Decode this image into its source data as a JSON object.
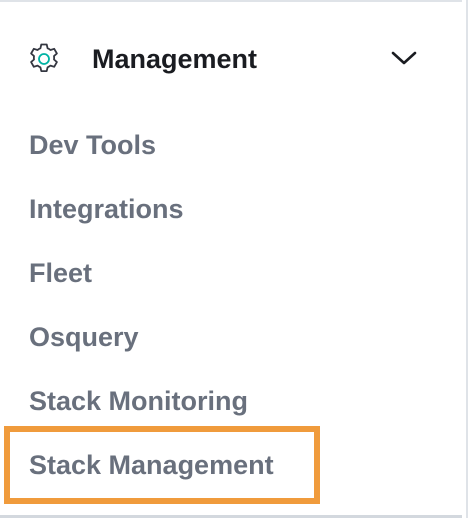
{
  "section": {
    "title": "Management",
    "icon": "gear-icon",
    "toggle_icon": "chevron-down-icon",
    "expanded": true
  },
  "nav": {
    "items": [
      {
        "label": "Dev Tools"
      },
      {
        "label": "Integrations"
      },
      {
        "label": "Fleet"
      },
      {
        "label": "Osquery"
      },
      {
        "label": "Stack Monitoring"
      },
      {
        "label": "Stack Management",
        "highlighted": true
      }
    ]
  },
  "colors": {
    "highlight": "#f09b3c",
    "title_text": "#1a1c21",
    "item_text": "#69707d",
    "icon_accent": "#00b3a4"
  }
}
